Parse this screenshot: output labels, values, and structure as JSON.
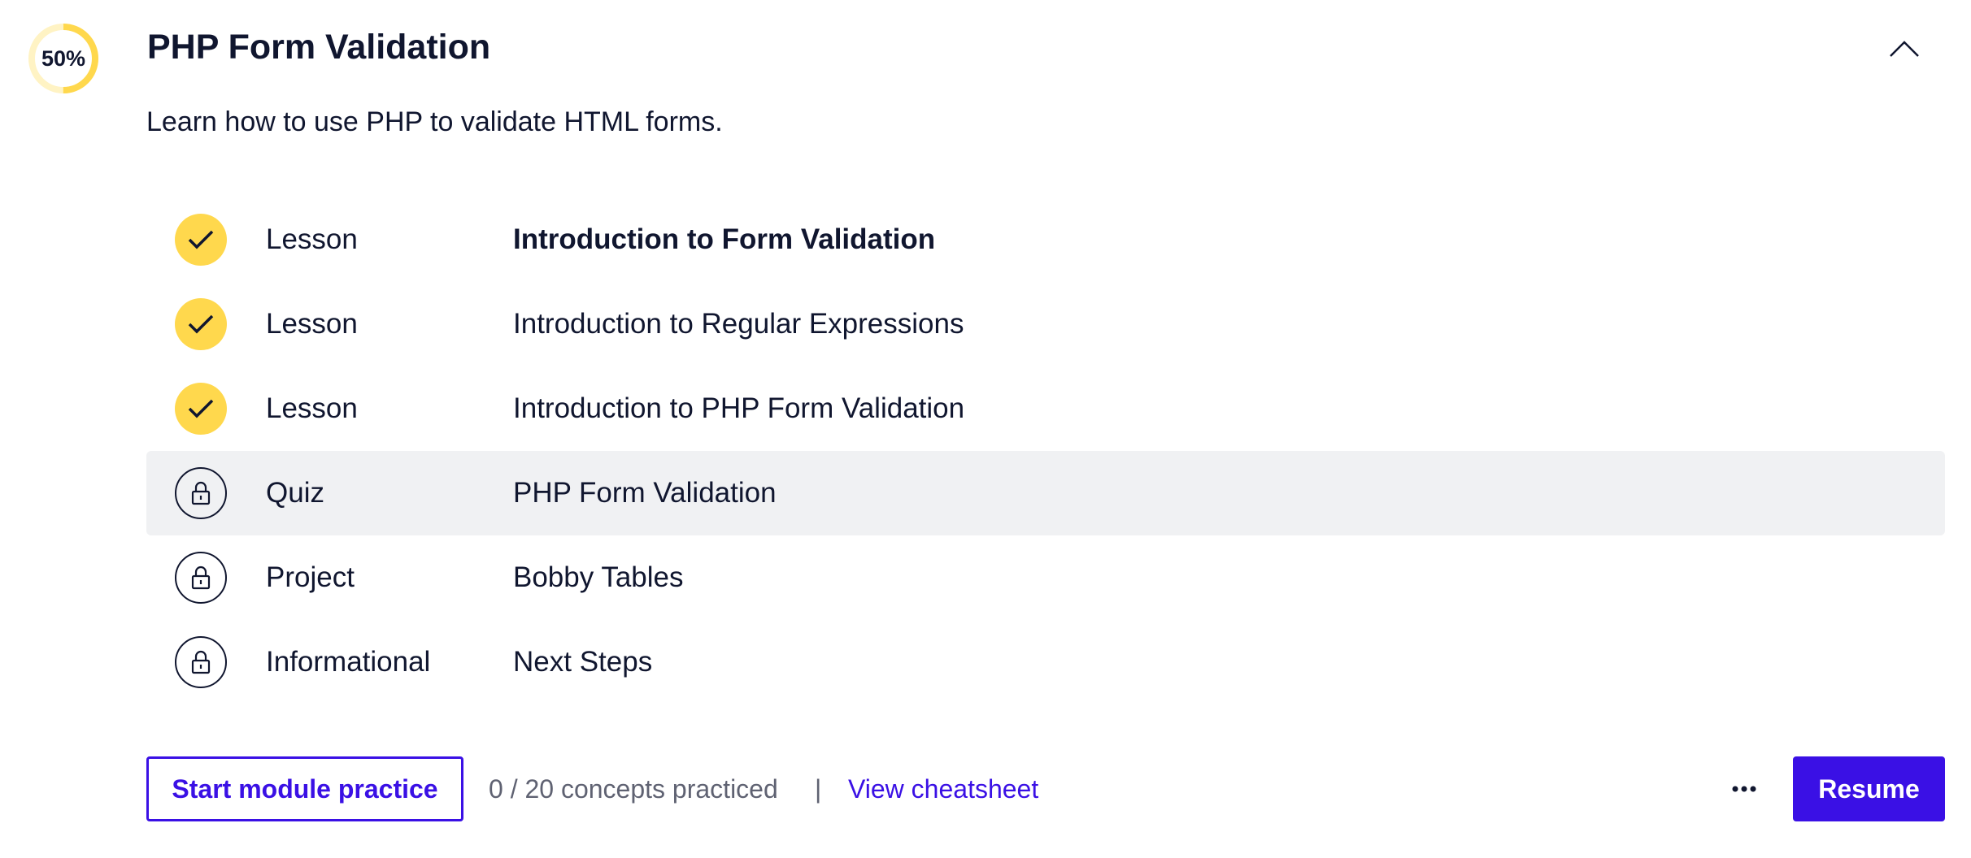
{
  "module": {
    "title": "PHP Form Validation",
    "description": "Learn how to use PHP to validate HTML forms.",
    "progress_label": "50%",
    "progress_fraction": 0.5,
    "collapse_icon": "chevron-up-icon"
  },
  "items": [
    {
      "type": "Lesson",
      "title": "Introduction to Form Validation",
      "status": "completed",
      "icon": "check-icon"
    },
    {
      "type": "Lesson",
      "title": "Introduction to Regular Expressions",
      "status": "completed",
      "icon": "check-icon"
    },
    {
      "type": "Lesson",
      "title": "Introduction to PHP Form Validation",
      "status": "completed",
      "icon": "check-icon"
    },
    {
      "type": "Quiz",
      "title": "PHP Form Validation",
      "status": "locked",
      "icon": "lock-icon"
    },
    {
      "type": "Project",
      "title": "Bobby Tables",
      "status": "locked",
      "icon": "lock-icon"
    },
    {
      "type": "Informational",
      "title": "Next Steps",
      "status": "locked",
      "icon": "lock-icon"
    }
  ],
  "footer": {
    "practice_label": "Start module practice",
    "concepts_text": "0 / 20 concepts practiced",
    "separator": "|",
    "cheatsheet_label": "View cheatsheet",
    "more_icon": "more-horizontal-icon",
    "resume_label": "Resume"
  },
  "colors": {
    "accent": "#3a10e5",
    "completed": "#ffd84d",
    "text": "#10162f",
    "muted": "#5f6272",
    "highlight_row": "#f0f1f3"
  }
}
